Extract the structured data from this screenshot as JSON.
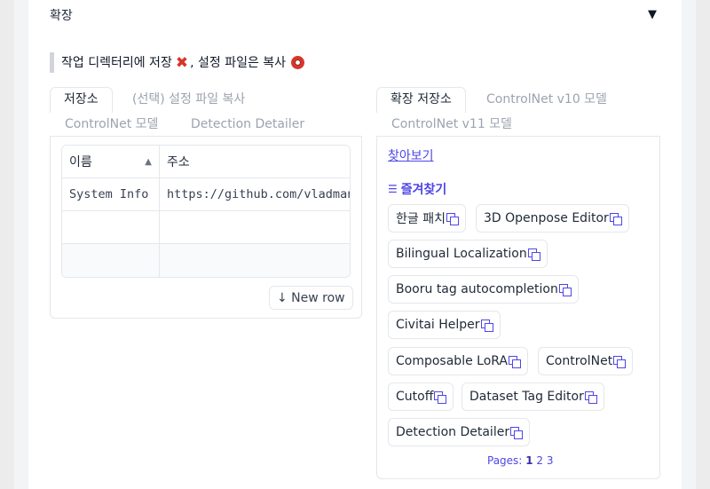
{
  "section": {
    "title": "확장",
    "toggle_icon": "triangle-down-icon"
  },
  "note": {
    "text": "작업 디렉터리에 저장",
    "text2": ", 설정 파일은 복사",
    "cross_icon": "cross-mark-icon",
    "circle_icon": "hollow-circle-icon",
    "accent": "#d9342b"
  },
  "left_tabs": [
    {
      "label": "저장소",
      "active": true
    },
    {
      "label": "(선택) 설정 파일 복사"
    },
    {
      "label": "ControlNet 모델"
    },
    {
      "label": "Detection Detailer"
    }
  ],
  "table": {
    "columns": [
      "이름",
      "주소"
    ],
    "rows": [
      [
        "System Info",
        "https://github.com/vladmandic/sd-extension-system-info"
      ],
      [
        "",
        ""
      ],
      [
        "",
        ""
      ]
    ],
    "new_row_label": "↓ New row"
  },
  "right_tabs": [
    {
      "label": "확장 저장소",
      "active": true
    },
    {
      "label": "ControlNet v10 모델"
    },
    {
      "label": "ControlNet v11 모델"
    }
  ],
  "browse": {
    "link": "찾아보기"
  },
  "favorites": {
    "title": "즐겨찾기",
    "items": [
      "한글 패치",
      "3D Openpose Editor",
      "Bilingual Localization",
      "Booru tag autocompletion",
      "Civitai Helper",
      "Composable LoRA",
      "ControlNet",
      "Cutoff",
      "Dataset Tag Editor",
      "Detection Detailer"
    ]
  },
  "pagination": {
    "label": "Pages:",
    "pages": [
      "1",
      "2",
      "3"
    ],
    "current": "1"
  },
  "colors": {
    "link": "#4f46e5",
    "border": "#e5e7eb"
  }
}
